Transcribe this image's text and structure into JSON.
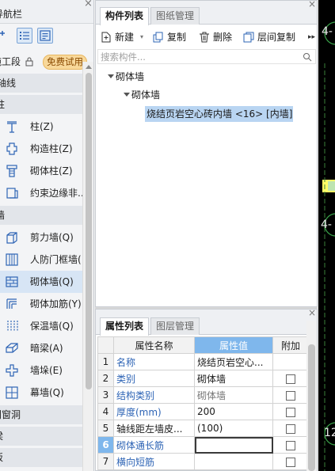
{
  "nav": {
    "title": "导航栏",
    "badge": "免费试用",
    "section0": "施工段",
    "sections": [
      "轴线",
      "柱",
      "墙",
      "门窗洞",
      "梁",
      "板"
    ],
    "column_items": [
      "柱(Z)",
      "构造柱(Z)",
      "砌体柱(Z)",
      "约束边缘非..."
    ],
    "wall_items": [
      "剪力墙(Q)",
      "人防门框墙(",
      "砌体墙(Q)",
      "砌体加筋(Y)",
      "保温墙(Q)",
      "暗梁(A)",
      "墙垛(E)",
      "幕墙(Q)"
    ]
  },
  "comp_panel": {
    "tabs": [
      "构件列表",
      "图纸管理"
    ],
    "toolbar": {
      "new": "新建",
      "copy": "复制",
      "delete": "删除",
      "floor_copy": "层间复制"
    },
    "search_placeholder": "搜索构件...",
    "tree": {
      "root": "砌体墙",
      "child": "砌体墙",
      "leaf": "烧结页岩空心砖内墙 <16> [内墙]"
    }
  },
  "prop_panel": {
    "tabs": [
      "属性列表",
      "图层管理"
    ],
    "headers": {
      "name": "属性名称",
      "value": "属性值",
      "extra": "附加"
    },
    "rows": [
      {
        "no": "1",
        "name": "名称",
        "value": "烧结页岩空心..."
      },
      {
        "no": "2",
        "name": "类别",
        "value": "砌体墙"
      },
      {
        "no": "3",
        "name": "结构类别",
        "value": "砌体墙"
      },
      {
        "no": "4",
        "name": "厚度(mm)",
        "value": "200"
      },
      {
        "no": "5",
        "name": "轴线距左墙皮...",
        "value": "(100)"
      },
      {
        "no": "6",
        "name": "砌体通长筋",
        "value": ""
      },
      {
        "no": "7",
        "name": "横向短筋",
        "value": ""
      }
    ]
  },
  "canvas": {
    "label_top": "4-",
    "label_mid": "4-",
    "label_bot": "12"
  },
  "colors": {
    "accent": "#7fb7ec",
    "selected_row": "#b9d5f2",
    "badge_bg": "#f8d89a",
    "link_blue": "#2e64b5"
  }
}
